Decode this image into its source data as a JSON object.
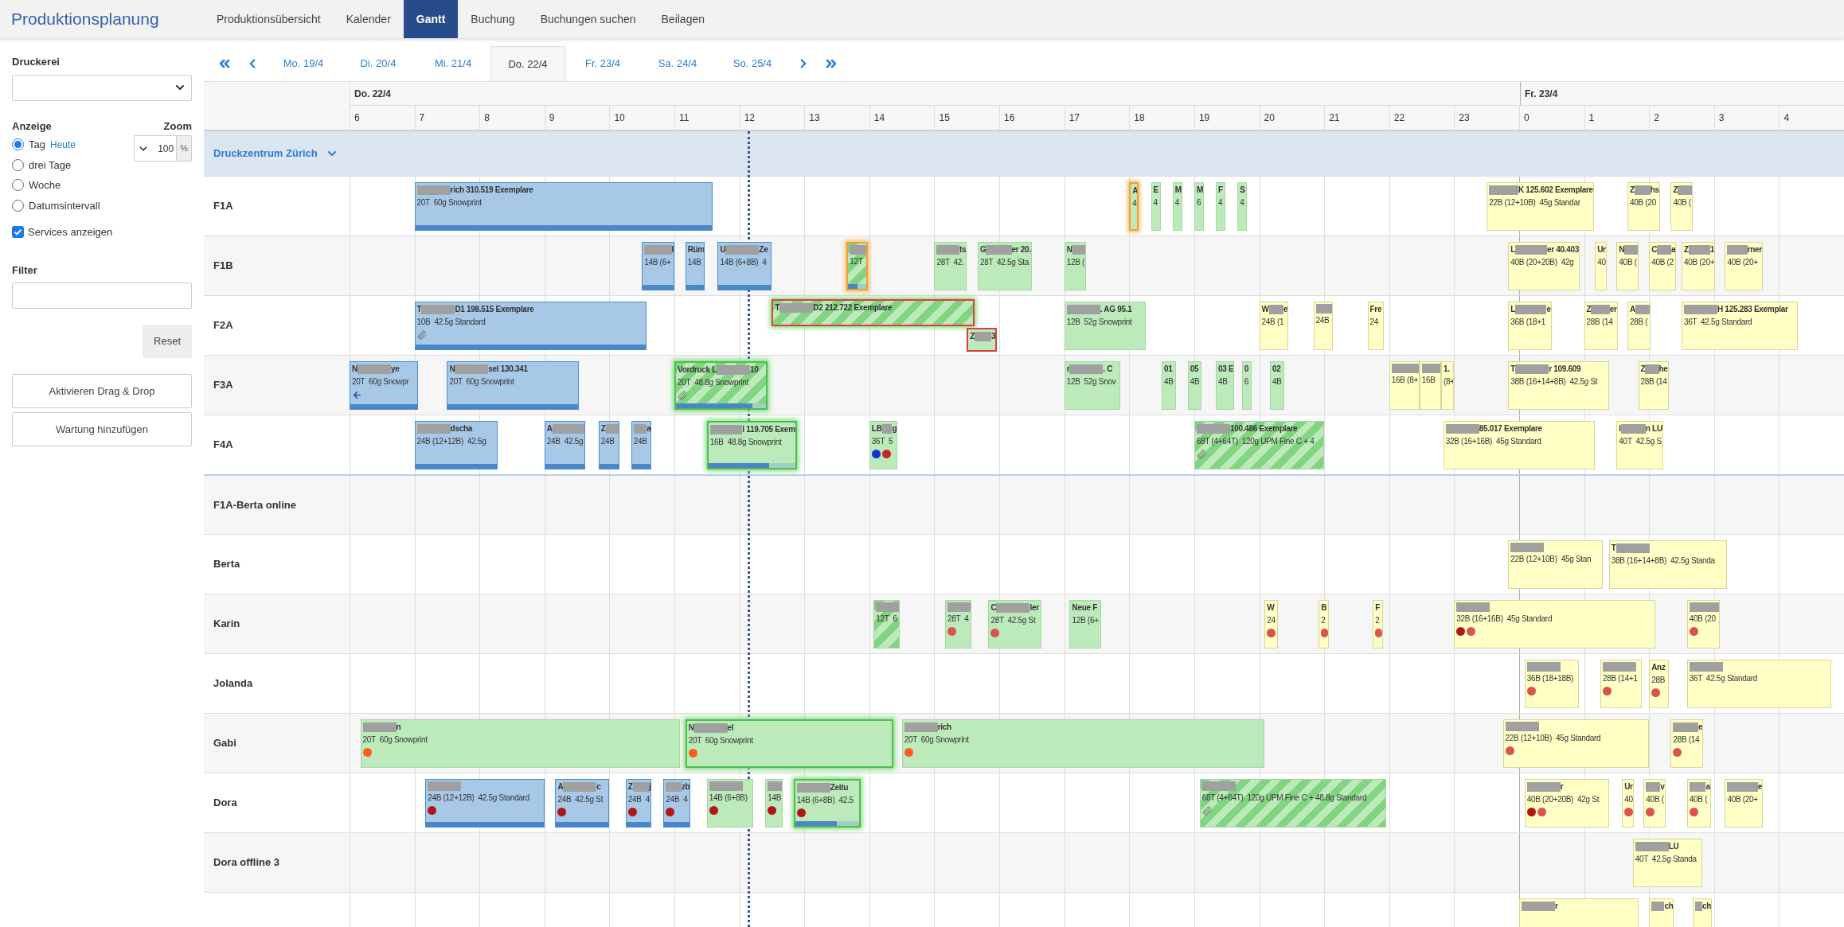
{
  "app": {
    "title": "Produktionsplanung"
  },
  "nav": [
    {
      "label": "Produktionsübersicht",
      "selected": false
    },
    {
      "label": "Kalender",
      "selected": false
    },
    {
      "label": "Gantt",
      "selected": true
    },
    {
      "label": "Buchung",
      "selected": false
    },
    {
      "label": "Buchungen suchen",
      "selected": false
    },
    {
      "label": "Beilagen",
      "selected": false
    }
  ],
  "sidebar": {
    "druckerei": {
      "label": "Druckerei"
    },
    "anzeige": {
      "label": "Anzeige",
      "options": [
        {
          "label": "Tag",
          "selected": true,
          "link": "Heute"
        },
        {
          "label": "drei Tage",
          "selected": false
        },
        {
          "label": "Woche",
          "selected": false
        },
        {
          "label": "Datumsintervall",
          "selected": false
        }
      ]
    },
    "zoom": {
      "label": "Zoom",
      "value": "100",
      "unit": "%"
    },
    "services": {
      "label": "Services anzeigen",
      "checked": true
    },
    "filter": {
      "label": "Filter"
    },
    "reset_button": "Reset",
    "buttons": [
      "Aktivieren Drag & Drop",
      "Wartung hinzufügen"
    ]
  },
  "date_tabs": [
    {
      "label": "Mo. 19/4",
      "selected": false
    },
    {
      "label": "Di. 20/4",
      "selected": false
    },
    {
      "label": "Mi. 21/4",
      "selected": false
    },
    {
      "label": "Do. 22/4",
      "selected": true
    },
    {
      "label": "Fr. 23/4",
      "selected": false
    },
    {
      "label": "Sa. 24/4",
      "selected": false
    },
    {
      "label": "So. 25/4",
      "selected": false
    }
  ],
  "timeline": {
    "days": [
      "Do. 22/4",
      "Fr. 23/4"
    ],
    "hours": [
      "6",
      "7",
      "8",
      "9",
      "10",
      "11",
      "12",
      "13",
      "14",
      "15",
      "16",
      "17",
      "18",
      "19",
      "20",
      "21",
      "22",
      "23",
      "0",
      "1",
      "2",
      "3",
      "4"
    ]
  },
  "group": {
    "label": "Druckzentrum Zürich",
    "expanded": true
  },
  "rows": [
    {
      "label": "F1A",
      "bars": [
        {
          "color": "#a8c8e8",
          "level": 1,
          "title": [
            {
              "kind": "redacted"
            },
            {
              "kind": "text",
              "text": "rich 310.519 Exemplare"
            }
          ],
          "detail": "20T  60g Snowprint"
        },
        {
          "color": "#bdeabb",
          "warning": true,
          "title": [
            {
              "kind": "text",
              "text": "A"
            }
          ],
          "detail": "4"
        },
        {
          "color": "#bdeabb",
          "title": [
            {
              "kind": "text",
              "text": "E"
            }
          ],
          "detail": "4"
        },
        {
          "color": "#bdeabb",
          "title": [
            {
              "kind": "text",
              "text": "M"
            }
          ],
          "detail": "4"
        },
        {
          "color": "#bdeabb",
          "title": [
            {
              "kind": "text",
              "text": "M"
            }
          ],
          "detail": "6"
        },
        {
          "color": "#bdeabb",
          "title": [
            {
              "kind": "text",
              "text": "F"
            }
          ],
          "detail": "4"
        },
        {
          "color": "#bdeabb",
          "title": [
            {
              "kind": "text",
              "text": "S"
            }
          ],
          "detail": "4"
        },
        {
          "color": "#ffffc6",
          "title": [
            {
              "kind": "redacted"
            },
            {
              "kind": "text",
              "text": "K 125.602 Exemplare"
            }
          ],
          "detail": "22B (12+10B)  45g Standar"
        },
        {
          "color": "#ffffc6",
          "title": [
            {
              "kind": "text",
              "text": "Z"
            },
            {
              "kind": "redacted"
            },
            {
              "kind": "text",
              "text": "hs"
            }
          ],
          "detail": "40B (20"
        },
        {
          "color": "#ffffc6",
          "title": [
            {
              "kind": "text",
              "text": "Z"
            },
            {
              "kind": "redacted"
            }
          ],
          "detail": "40B ("
        }
      ]
    },
    {
      "label": "F1B",
      "bars": [
        {
          "color": "#a8c8e8",
          "level": 1,
          "title": [
            {
              "kind": "redacted"
            },
            {
              "kind": "text",
              "text": "l"
            }
          ],
          "detail": "14B (6+"
        },
        {
          "color": "#a8c8e8",
          "level": 1,
          "title": [
            {
              "kind": "text",
              "text": "Rüm"
            }
          ],
          "detail": "14B"
        },
        {
          "color": "#a8c8e8",
          "level": 1,
          "title": [
            {
              "kind": "text",
              "text": "U"
            },
            {
              "kind": "redacted"
            },
            {
              "kind": "text",
              "text": "Ze"
            }
          ],
          "detail": "14B (6+8B)  4"
        },
        {
          "color": "#bdeabb",
          "hatched": true,
          "warning": true,
          "level": 0.5,
          "title": [
            {
              "kind": "redacted"
            }
          ],
          "detail": "12T"
        },
        {
          "color": "#bdeabb",
          "title": [
            {
              "kind": "redacted"
            },
            {
              "kind": "text",
              "text": "ts"
            }
          ],
          "detail": "28T  42."
        },
        {
          "color": "#bdeabb",
          "title": [
            {
              "kind": "text",
              "text": "G"
            },
            {
              "kind": "redacted"
            },
            {
              "kind": "text",
              "text": "er 20."
            }
          ],
          "detail": "28T  42.5g Sta"
        },
        {
          "color": "#bdeabb",
          "title": [
            {
              "kind": "text",
              "text": "N"
            },
            {
              "kind": "redacted"
            }
          ],
          "detail": "12B ("
        },
        {
          "color": "#ffffc6",
          "title": [
            {
              "kind": "text",
              "text": "L"
            },
            {
              "kind": "redacted"
            },
            {
              "kind": "text",
              "text": "er 40.403"
            }
          ],
          "detail": "40B (20+20B)  42g"
        },
        {
          "color": "#ffffc6",
          "title": [
            {
              "kind": "text",
              "text": "Ur"
            }
          ],
          "detail": "40"
        },
        {
          "color": "#ffffc6",
          "title": [
            {
              "kind": "text",
              "text": "N"
            },
            {
              "kind": "redacted"
            }
          ],
          "detail": "40B ("
        },
        {
          "color": "#ffffc6",
          "title": [
            {
              "kind": "text",
              "text": "C"
            },
            {
              "kind": "redacted"
            },
            {
              "kind": "text",
              "text": "a"
            }
          ],
          "detail": "40B (2"
        },
        {
          "color": "#ffffc6",
          "title": [
            {
              "kind": "text",
              "text": "Z"
            },
            {
              "kind": "redacted"
            },
            {
              "kind": "text",
              "text": "1"
            }
          ],
          "detail": "40B (20+"
        },
        {
          "color": "#ffffc6",
          "title": [
            {
              "kind": "redacted"
            },
            {
              "kind": "text",
              "text": "rner"
            }
          ],
          "detail": "40B (20+"
        }
      ]
    },
    {
      "label": "F2A",
      "bars": [
        {
          "color": "#a8c8e8",
          "level": 1,
          "attachment": true,
          "title": [
            {
              "kind": "text",
              "text": "T"
            },
            {
              "kind": "redacted"
            },
            {
              "kind": "text",
              "text": "D1 198.515 Exemplare"
            }
          ],
          "detail": "10B  42.5g Standard"
        },
        {
          "color": "#bdeabb",
          "hatched": true,
          "selected": true,
          "conflict": true,
          "title": [
            {
              "kind": "text",
              "text": "T"
            },
            {
              "kind": "redacted"
            },
            {
              "kind": "text",
              "text": "D2 212.722 Exemplare"
            }
          ]
        },
        {
          "color": "#bdeabb",
          "conflict": true,
          "title": [
            {
              "kind": "text",
              "text": "Z"
            },
            {
              "kind": "redacted"
            },
            {
              "kind": "text",
              "text": "3"
            }
          ]
        },
        {
          "color": "#bdeabb",
          "title": [
            {
              "kind": "redacted"
            },
            {
              "kind": "text",
              "text": ". AG 95.1"
            }
          ],
          "detail": "12B  52g Snowprint"
        },
        {
          "color": "#ffffc6",
          "title": [
            {
              "kind": "text",
              "text": "W"
            },
            {
              "kind": "redacted"
            },
            {
              "kind": "text",
              "text": "e"
            }
          ],
          "detail": "24B (1"
        },
        {
          "color": "#ffffc6",
          "title": [
            {
              "kind": "redacted"
            }
          ],
          "detail": "24B"
        },
        {
          "color": "#ffffc6",
          "title": [
            {
              "kind": "text",
              "text": "Fre"
            }
          ],
          "detail": "24"
        },
        {
          "color": "#ffffc6",
          "title": [
            {
              "kind": "text",
              "text": "L"
            },
            {
              "kind": "redacted"
            },
            {
              "kind": "text",
              "text": "e"
            }
          ],
          "detail": "36B (18+1"
        },
        {
          "color": "#ffffc6",
          "title": [
            {
              "kind": "text",
              "text": "Z"
            },
            {
              "kind": "redacted"
            },
            {
              "kind": "text",
              "text": "er"
            }
          ],
          "detail": "28B (14"
        },
        {
          "color": "#ffffc6",
          "title": [
            {
              "kind": "text",
              "text": "A"
            },
            {
              "kind": "redacted"
            }
          ],
          "detail": "28B ("
        },
        {
          "color": "#ffffc6",
          "title": [
            {
              "kind": "redacted"
            },
            {
              "kind": "text",
              "text": "H 125.283 Exemplar"
            }
          ],
          "detail": "36T  42.5g Standard"
        }
      ]
    },
    {
      "label": "F3A",
      "bars": [
        {
          "color": "#a8c8e8",
          "level": 1,
          "arrow": true,
          "title": [
            {
              "kind": "text",
              "text": "N"
            },
            {
              "kind": "redacted"
            },
            {
              "kind": "text",
              "text": "ye"
            }
          ],
          "detail": "20T  60g Snowpr"
        },
        {
          "color": "#a8c8e8",
          "level": 1,
          "title": [
            {
              "kind": "text",
              "text": "N"
            },
            {
              "kind": "redacted"
            },
            {
              "kind": "text",
              "text": "sel 130.341"
            }
          ],
          "detail": "20T  60g Snowprint"
        },
        {
          "color": "#bdeabb",
          "hatched": true,
          "selected": true,
          "level": 0.85,
          "attachment": true,
          "title": [
            {
              "kind": "text",
              "text": "Vordruck L"
            },
            {
              "kind": "redacted"
            },
            {
              "kind": "text",
              "text": "10"
            }
          ],
          "detail": "20T  48.8g Snowprint"
        },
        {
          "color": "#bdeabb",
          "title": [
            {
              "kind": "text",
              "text": "r"
            },
            {
              "kind": "redacted"
            },
            {
              "kind": "text",
              "text": ". C"
            }
          ],
          "detail": "12B  52g Snov"
        },
        {
          "color": "#bdeabb",
          "title": [
            {
              "kind": "text",
              "text": "01"
            }
          ],
          "detail": "4B"
        },
        {
          "color": "#bdeabb",
          "title": [
            {
              "kind": "text",
              "text": "05"
            }
          ],
          "detail": "4B"
        },
        {
          "color": "#bdeabb",
          "title": [
            {
              "kind": "text",
              "text": "03 E"
            }
          ],
          "detail": "4B"
        },
        {
          "color": "#bdeabb",
          "title": [
            {
              "kind": "text",
              "text": "0"
            }
          ],
          "detail": "6"
        },
        {
          "color": "#bdeabb",
          "title": [
            {
              "kind": "text",
              "text": "02"
            }
          ],
          "detail": "4B"
        },
        {
          "color": "#ffffc6",
          "title": [
            {
              "kind": "redacted"
            }
          ],
          "detail": "16B (8+"
        },
        {
          "color": "#ffffc6",
          "title": [
            {
              "kind": "redacted"
            }
          ],
          "detail": "16B"
        },
        {
          "color": "#ffffc6",
          "title": [
            {
              "kind": "text",
              "text": "1."
            }
          ],
          "detail": "(8+"
        },
        {
          "color": "#ffffc6",
          "title": [
            {
              "kind": "text",
              "text": "T"
            },
            {
              "kind": "redacted"
            },
            {
              "kind": "text",
              "text": "r 109.609"
            }
          ],
          "detail": "38B (16+14+8B)  42.5g St"
        },
        {
          "color": "#ffffc6",
          "title": [
            {
              "kind": "text",
              "text": "Z"
            },
            {
              "kind": "redacted"
            },
            {
              "kind": "text",
              "text": "he"
            }
          ],
          "detail": "28B (14"
        }
      ]
    },
    {
      "label": "F4A",
      "bars": [
        {
          "color": "#a8c8e8",
          "level": 1,
          "title": [
            {
              "kind": "redacted"
            },
            {
              "kind": "text",
              "text": "dscha"
            }
          ],
          "detail": "24B (12+12B)  42.5g"
        },
        {
          "color": "#a8c8e8",
          "level": 1,
          "title": [
            {
              "kind": "text",
              "text": "A"
            },
            {
              "kind": "redacted"
            }
          ],
          "detail": "24B  42.5g"
        },
        {
          "color": "#a8c8e8",
          "level": 1,
          "title": [
            {
              "kind": "text",
              "text": "Z"
            },
            {
              "kind": "redacted"
            }
          ],
          "detail": "24B"
        },
        {
          "color": "#a8c8e8",
          "level": 1,
          "title": [
            {
              "kind": "redacted"
            },
            {
              "kind": "text",
              "text": "a"
            }
          ],
          "detail": "24B"
        },
        {
          "color": "#bdeabb",
          "selected": true,
          "level": 0.7,
          "title": [
            {
              "kind": "redacted"
            },
            {
              "kind": "text",
              "text": "l 119.705 Exem"
            }
          ],
          "detail": "16B  48.8g Snowprint"
        },
        {
          "color": "#bdeabb",
          "title": [
            {
              "kind": "text",
              "text": "LB"
            },
            {
              "kind": "redacted"
            },
            {
              "kind": "text",
              "text": "g"
            }
          ],
          "detail": "36T  5",
          "dots": [
            {
              "color": "#1133cc"
            },
            {
              "color": "#cc2222"
            }
          ]
        },
        {
          "color": "#bdeabb",
          "hatched": true,
          "attachment": true,
          "title": [
            {
              "kind": "redacted"
            },
            {
              "kind": "text",
              "text": "100.486 Exemplare"
            }
          ],
          "detail": "68T (4+64T)  120g UPM Fine C + 4"
        },
        {
          "color": "#ffffc6",
          "title": [
            {
              "kind": "redacted"
            },
            {
              "kind": "text",
              "text": "85.017 Exemplare"
            }
          ],
          "detail": "32B (16+16B)  45g Standard"
        },
        {
          "color": "#ffffc6",
          "title": [
            {
              "kind": "text",
              "text": "I"
            },
            {
              "kind": "redacted"
            },
            {
              "kind": "text",
              "text": "n LU"
            }
          ],
          "detail": "40T  42.5g S"
        }
      ]
    },
    {
      "label": "F1A-Berta online",
      "separator": true,
      "bars": []
    },
    {
      "label": "Berta",
      "bars": [
        {
          "color": "#ffffc6",
          "title": [
            {
              "kind": "redacted"
            }
          ],
          "detail": "22B (12+10B)  45g Stan"
        },
        {
          "color": "#ffffc6",
          "title": [
            {
              "kind": "text",
              "text": "T"
            },
            {
              "kind": "redacted"
            }
          ],
          "detail": "38B (16+14+8B)  42.5g Standa"
        }
      ]
    },
    {
      "label": "Karin",
      "bars": [
        {
          "color": "#bdeabb",
          "hatched": true,
          "title": [
            {
              "kind": "redacted"
            }
          ],
          "detail": "12T  6"
        },
        {
          "color": "#bdeabb",
          "title": [
            {
              "kind": "redacted"
            }
          ],
          "detail": "28T  4",
          "dots": [
            {
              "color": "#d9534f"
            }
          ]
        },
        {
          "color": "#bdeabb",
          "title": [
            {
              "kind": "text",
              "text": "C"
            },
            {
              "kind": "redacted"
            },
            {
              "kind": "text",
              "text": "ler"
            }
          ],
          "detail": "28T  42.5g St",
          "dots": [
            {
              "color": "#d9534f"
            }
          ]
        },
        {
          "color": "#bdeabb",
          "title": [
            {
              "kind": "text",
              "text": "Neue F"
            }
          ],
          "detail": "12B (6+"
        },
        {
          "color": "#ffffc6",
          "title": [
            {
              "kind": "text",
              "text": "W"
            }
          ],
          "detail": "24",
          "dots": [
            {
              "color": "#d9534f"
            }
          ]
        },
        {
          "color": "#ffffc6",
          "title": [
            {
              "kind": "text",
              "text": "B"
            }
          ],
          "detail": "2",
          "dots": [
            {
              "color": "#d9534f"
            }
          ]
        },
        {
          "color": "#ffffc6",
          "title": [
            {
              "kind": "text",
              "text": "F"
            }
          ],
          "detail": "2",
          "dots": [
            {
              "color": "#d9534f"
            }
          ]
        },
        {
          "color": "#ffffc6",
          "title": [
            {
              "kind": "redacted"
            }
          ],
          "detail": "32B (16+16B)  45g Standard",
          "dots": [
            {
              "color": "#b01818"
            },
            {
              "color": "#d9534f"
            }
          ]
        },
        {
          "color": "#ffffc6",
          "title": [
            {
              "kind": "redacted"
            }
          ],
          "detail": "40B (20",
          "dots": [
            {
              "color": "#d9534f"
            }
          ]
        }
      ]
    },
    {
      "label": "Jolanda",
      "bars": [
        {
          "color": "#ffffc6",
          "title": [
            {
              "kind": "redacted"
            }
          ],
          "detail": "36B (18+18B)",
          "dots": [
            {
              "color": "#d9534f"
            }
          ]
        },
        {
          "color": "#ffffc6",
          "title": [
            {
              "kind": "redacted"
            }
          ],
          "detail": "28B (14+1",
          "dots": [
            {
              "color": "#d9534f"
            }
          ]
        },
        {
          "color": "#ffffc6",
          "title": [
            {
              "kind": "text",
              "text": "Anz"
            }
          ],
          "detail": "28B",
          "dots": [
            {
              "color": "#d9534f"
            }
          ]
        },
        {
          "color": "#ffffc6",
          "title": [
            {
              "kind": "redacted"
            }
          ],
          "detail": "36T  42.5g Standard"
        }
      ]
    },
    {
      "label": "Gabi",
      "bars": [
        {
          "color": "#bdeabb",
          "title": [
            {
              "kind": "redacted"
            },
            {
              "kind": "text",
              "text": "n"
            }
          ],
          "detail": "20T  60g Snowprint",
          "dots": [
            {
              "color": "#ff5a1f"
            }
          ]
        },
        {
          "color": "#bdeabb",
          "selected": true,
          "title": [
            {
              "kind": "text",
              "text": "N"
            },
            {
              "kind": "redacted"
            },
            {
              "kind": "text",
              "text": "el"
            }
          ],
          "detail": "20T  60g Snowprint",
          "dots": [
            {
              "color": "#ff5a1f"
            }
          ]
        },
        {
          "color": "#bdeabb",
          "title": [
            {
              "kind": "redacted"
            },
            {
              "kind": "text",
              "text": "rich"
            }
          ],
          "detail": "20T  60g Snowprint",
          "dots": [
            {
              "color": "#ff5a1f"
            }
          ]
        },
        {
          "color": "#ffffc6",
          "title": [
            {
              "kind": "redacted"
            }
          ],
          "detail": "22B (12+10B)  45g Standard",
          "dots": [
            {
              "color": "#d9534f"
            }
          ]
        },
        {
          "color": "#ffffc6",
          "title": [
            {
              "kind": "redacted"
            },
            {
              "kind": "text",
              "text": "e"
            }
          ],
          "detail": "28B (14",
          "dots": [
            {
              "color": "#d9534f"
            }
          ]
        }
      ]
    },
    {
      "label": "Dora",
      "bars": [
        {
          "color": "#a8c8e8",
          "level": 1,
          "title": [
            {
              "kind": "redacted"
            }
          ],
          "detail": "24B (12+12B)  42.5g Standard",
          "dots": [
            {
              "color": "#b01818"
            }
          ]
        },
        {
          "color": "#a8c8e8",
          "level": 1,
          "title": [
            {
              "kind": "text",
              "text": "A"
            },
            {
              "kind": "redacted"
            },
            {
              "kind": "text",
              "text": "c"
            }
          ],
          "detail": "24B  42.5g St",
          "dots": [
            {
              "color": "#b01818"
            }
          ]
        },
        {
          "color": "#a8c8e8",
          "level": 1,
          "title": [
            {
              "kind": "text",
              "text": "Z"
            },
            {
              "kind": "redacted"
            },
            {
              "kind": "text",
              "text": "j"
            }
          ],
          "detail": "24B  4",
          "dots": [
            {
              "color": "#b01818"
            }
          ]
        },
        {
          "color": "#a8c8e8",
          "level": 1,
          "title": [
            {
              "kind": "redacted"
            },
            {
              "kind": "text",
              "text": "zb"
            }
          ],
          "detail": "24B  4",
          "dots": [
            {
              "color": "#b01818"
            }
          ]
        },
        {
          "color": "#bdeabb",
          "title": [
            {
              "kind": "redacted"
            }
          ],
          "detail": "14B (6+8B)",
          "dots": [
            {
              "color": "#b01818"
            }
          ]
        },
        {
          "color": "#bdeabb",
          "title": [
            {
              "kind": "redacted"
            }
          ],
          "detail": "14B",
          "dots": [
            {
              "color": "#b01818"
            }
          ]
        },
        {
          "color": "#bdeabb",
          "selected": true,
          "level": 0.65,
          "title": [
            {
              "kind": "redacted"
            },
            {
              "kind": "text",
              "text": "Zeitu"
            }
          ],
          "detail": "14B (6+8B)  42.5",
          "dots": [
            {
              "color": "#b01818"
            }
          ]
        },
        {
          "color": "#bdeabb",
          "hatched": true,
          "attachment": true,
          "title": [
            {
              "kind": "redacted"
            }
          ],
          "detail": "68T (4+64T)  120g UPM Fine C + 48.8g Standard"
        },
        {
          "color": "#ffffc6",
          "title": [
            {
              "kind": "redacted"
            },
            {
              "kind": "text",
              "text": "r"
            }
          ],
          "detail": "40B (20+20B)  42g St",
          "dots": [
            {
              "color": "#b01818"
            },
            {
              "color": "#d9534f"
            }
          ]
        },
        {
          "color": "#ffffc6",
          "title": [
            {
              "kind": "text",
              "text": "Ur"
            }
          ],
          "detail": "40",
          "dots": [
            {
              "color": "#d9534f"
            }
          ]
        },
        {
          "color": "#ffffc6",
          "title": [
            {
              "kind": "redacted"
            },
            {
              "kind": "text",
              "text": "v"
            }
          ],
          "detail": "40B (",
          "dots": [
            {
              "color": "#d9534f"
            }
          ]
        },
        {
          "color": "#ffffc6",
          "title": [
            {
              "kind": "redacted"
            },
            {
              "kind": "text",
              "text": "a"
            }
          ],
          "detail": "40B (",
          "dots": [
            {
              "color": "#d9534f"
            }
          ]
        },
        {
          "color": "#ffffc6",
          "title": [
            {
              "kind": "redacted"
            },
            {
              "kind": "text",
              "text": "e"
            }
          ],
          "detail": "40B (20+"
        }
      ]
    },
    {
      "label": "Dora offline 3",
      "bars": [
        {
          "color": "#ffffc6",
          "title": [
            {
              "kind": "redacted"
            },
            {
              "kind": "text",
              "text": "LU"
            }
          ],
          "detail": "40T  42.5g Standa"
        }
      ]
    },
    {
      "bars": [
        {
          "color": "#ffffc6",
          "title": [
            {
              "kind": "redacted"
            },
            {
              "kind": "text",
              "text": "r"
            }
          ]
        },
        {
          "color": "#ffffc6",
          "title": [
            {
              "kind": "redacted"
            },
            {
              "kind": "text",
              "text": "ch"
            }
          ]
        },
        {
          "color": "#ffffc6",
          "title": [
            {
              "kind": "redacted"
            },
            {
              "kind": "text",
              "text": "ch"
            }
          ]
        }
      ]
    }
  ]
}
